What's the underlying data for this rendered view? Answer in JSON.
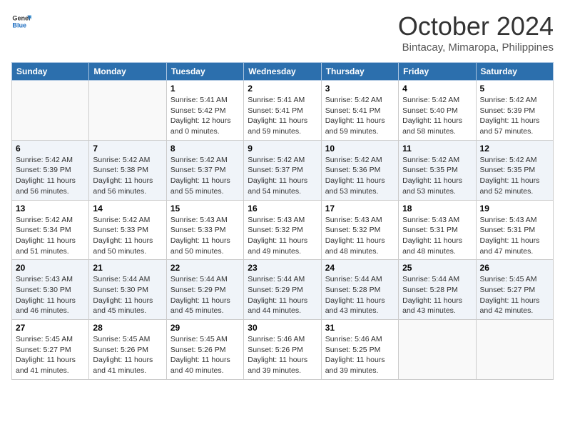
{
  "header": {
    "logo_general": "General",
    "logo_blue": "Blue",
    "month": "October 2024",
    "location": "Bintacay, Mimaropa, Philippines"
  },
  "weekdays": [
    "Sunday",
    "Monday",
    "Tuesday",
    "Wednesday",
    "Thursday",
    "Friday",
    "Saturday"
  ],
  "weeks": [
    [
      {
        "day": "",
        "info": ""
      },
      {
        "day": "",
        "info": ""
      },
      {
        "day": "1",
        "info": "Sunrise: 5:41 AM\nSunset: 5:42 PM\nDaylight: 12 hours\nand 0 minutes."
      },
      {
        "day": "2",
        "info": "Sunrise: 5:41 AM\nSunset: 5:41 PM\nDaylight: 11 hours\nand 59 minutes."
      },
      {
        "day": "3",
        "info": "Sunrise: 5:42 AM\nSunset: 5:41 PM\nDaylight: 11 hours\nand 59 minutes."
      },
      {
        "day": "4",
        "info": "Sunrise: 5:42 AM\nSunset: 5:40 PM\nDaylight: 11 hours\nand 58 minutes."
      },
      {
        "day": "5",
        "info": "Sunrise: 5:42 AM\nSunset: 5:39 PM\nDaylight: 11 hours\nand 57 minutes."
      }
    ],
    [
      {
        "day": "6",
        "info": "Sunrise: 5:42 AM\nSunset: 5:39 PM\nDaylight: 11 hours\nand 56 minutes."
      },
      {
        "day": "7",
        "info": "Sunrise: 5:42 AM\nSunset: 5:38 PM\nDaylight: 11 hours\nand 56 minutes."
      },
      {
        "day": "8",
        "info": "Sunrise: 5:42 AM\nSunset: 5:37 PM\nDaylight: 11 hours\nand 55 minutes."
      },
      {
        "day": "9",
        "info": "Sunrise: 5:42 AM\nSunset: 5:37 PM\nDaylight: 11 hours\nand 54 minutes."
      },
      {
        "day": "10",
        "info": "Sunrise: 5:42 AM\nSunset: 5:36 PM\nDaylight: 11 hours\nand 53 minutes."
      },
      {
        "day": "11",
        "info": "Sunrise: 5:42 AM\nSunset: 5:35 PM\nDaylight: 11 hours\nand 53 minutes."
      },
      {
        "day": "12",
        "info": "Sunrise: 5:42 AM\nSunset: 5:35 PM\nDaylight: 11 hours\nand 52 minutes."
      }
    ],
    [
      {
        "day": "13",
        "info": "Sunrise: 5:42 AM\nSunset: 5:34 PM\nDaylight: 11 hours\nand 51 minutes."
      },
      {
        "day": "14",
        "info": "Sunrise: 5:42 AM\nSunset: 5:33 PM\nDaylight: 11 hours\nand 50 minutes."
      },
      {
        "day": "15",
        "info": "Sunrise: 5:43 AM\nSunset: 5:33 PM\nDaylight: 11 hours\nand 50 minutes."
      },
      {
        "day": "16",
        "info": "Sunrise: 5:43 AM\nSunset: 5:32 PM\nDaylight: 11 hours\nand 49 minutes."
      },
      {
        "day": "17",
        "info": "Sunrise: 5:43 AM\nSunset: 5:32 PM\nDaylight: 11 hours\nand 48 minutes."
      },
      {
        "day": "18",
        "info": "Sunrise: 5:43 AM\nSunset: 5:31 PM\nDaylight: 11 hours\nand 48 minutes."
      },
      {
        "day": "19",
        "info": "Sunrise: 5:43 AM\nSunset: 5:31 PM\nDaylight: 11 hours\nand 47 minutes."
      }
    ],
    [
      {
        "day": "20",
        "info": "Sunrise: 5:43 AM\nSunset: 5:30 PM\nDaylight: 11 hours\nand 46 minutes."
      },
      {
        "day": "21",
        "info": "Sunrise: 5:44 AM\nSunset: 5:30 PM\nDaylight: 11 hours\nand 45 minutes."
      },
      {
        "day": "22",
        "info": "Sunrise: 5:44 AM\nSunset: 5:29 PM\nDaylight: 11 hours\nand 45 minutes."
      },
      {
        "day": "23",
        "info": "Sunrise: 5:44 AM\nSunset: 5:29 PM\nDaylight: 11 hours\nand 44 minutes."
      },
      {
        "day": "24",
        "info": "Sunrise: 5:44 AM\nSunset: 5:28 PM\nDaylight: 11 hours\nand 43 minutes."
      },
      {
        "day": "25",
        "info": "Sunrise: 5:44 AM\nSunset: 5:28 PM\nDaylight: 11 hours\nand 43 minutes."
      },
      {
        "day": "26",
        "info": "Sunrise: 5:45 AM\nSunset: 5:27 PM\nDaylight: 11 hours\nand 42 minutes."
      }
    ],
    [
      {
        "day": "27",
        "info": "Sunrise: 5:45 AM\nSunset: 5:27 PM\nDaylight: 11 hours\nand 41 minutes."
      },
      {
        "day": "28",
        "info": "Sunrise: 5:45 AM\nSunset: 5:26 PM\nDaylight: 11 hours\nand 41 minutes."
      },
      {
        "day": "29",
        "info": "Sunrise: 5:45 AM\nSunset: 5:26 PM\nDaylight: 11 hours\nand 40 minutes."
      },
      {
        "day": "30",
        "info": "Sunrise: 5:46 AM\nSunset: 5:26 PM\nDaylight: 11 hours\nand 39 minutes."
      },
      {
        "day": "31",
        "info": "Sunrise: 5:46 AM\nSunset: 5:25 PM\nDaylight: 11 hours\nand 39 minutes."
      },
      {
        "day": "",
        "info": ""
      },
      {
        "day": "",
        "info": ""
      }
    ]
  ]
}
